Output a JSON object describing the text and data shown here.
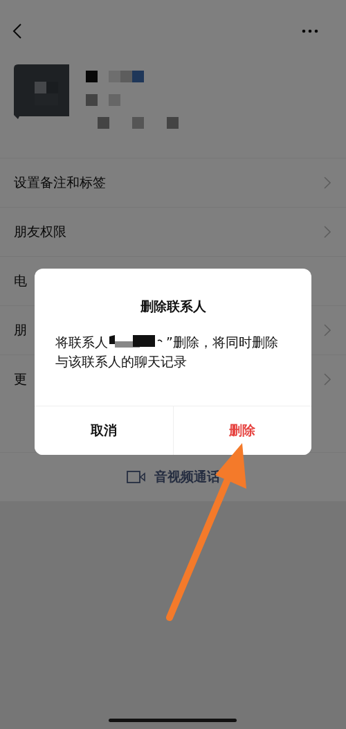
{
  "menu_sections": [
    [
      {
        "label": "设置备注和标签",
        "chevron": true
      },
      {
        "label": "朋友权限",
        "chevron": true
      },
      {
        "label": "电",
        "chevron": false
      }
    ],
    [
      {
        "label": "朋",
        "chevron": true
      },
      {
        "label": "更",
        "chevron": true
      }
    ]
  ],
  "actions": [
    {
      "label": "音视频通话",
      "kind": "video"
    }
  ],
  "dialog": {
    "title": "删除联系人",
    "message_start": "将联系人",
    "message_middle": "”删除，将同时删除",
    "message_end": "与该联系人的聊天记录",
    "buttons": [
      {
        "label": "取消",
        "kind": "cancel"
      },
      {
        "label": "删除",
        "kind": "destructive"
      }
    ]
  }
}
